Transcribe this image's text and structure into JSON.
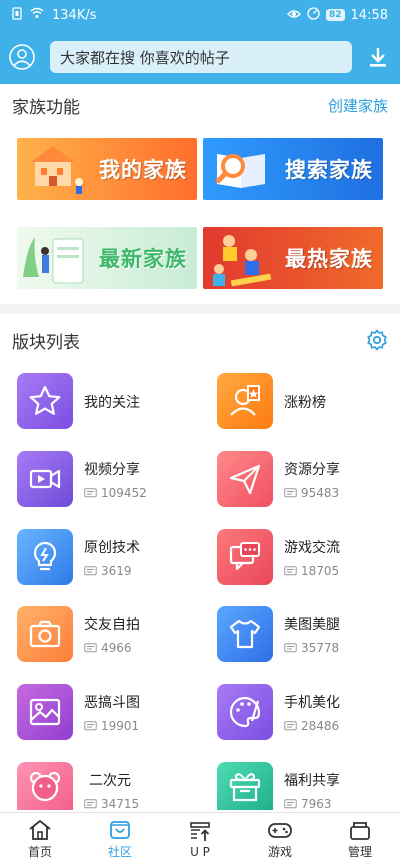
{
  "status": {
    "speed": "134K/s",
    "battery": "82",
    "time": "14:58"
  },
  "header": {
    "search_placeholder": "大家都在搜  你喜欢的帖子"
  },
  "family": {
    "title": "家族功能",
    "link": "创建家族",
    "banners": [
      {
        "label": "我的家族",
        "color_from": "#ff9d3c",
        "color_to": "#ff6e2c"
      },
      {
        "label": "搜索家族",
        "color_from": "#1f7fe6",
        "color_to": "#2fb0ff"
      },
      {
        "label": "最新家族",
        "color_from": "#e6f6e8",
        "color_to": "#cdeed8"
      },
      {
        "label": "最热家族",
        "color_from": "#d92f2f",
        "color_to": "#f06a2a"
      }
    ]
  },
  "boards": {
    "title": "版块列表",
    "items": [
      {
        "name": "我的关注",
        "count": "",
        "icon": "star-icon",
        "c1": "#9b6df0",
        "c2": "#7b4fe0"
      },
      {
        "name": "涨粉榜",
        "count": "",
        "icon": "fans-rank-icon",
        "c1": "#ff9a2c",
        "c2": "#ff7a12"
      },
      {
        "name": "视频分享",
        "count": "109452",
        "icon": "video-icon",
        "c1": "#9b6df0",
        "c2": "#6f4bd8"
      },
      {
        "name": "资源分享",
        "count": "95483",
        "icon": "paper-plane-icon",
        "c1": "#ff7a7a",
        "c2": "#f04f5f"
      },
      {
        "name": "原创技术",
        "count": "3619",
        "icon": "bulb-icon",
        "c1": "#5aa8ff",
        "c2": "#2f7be8"
      },
      {
        "name": "游戏交流",
        "count": "18705",
        "icon": "chat-icon",
        "c1": "#ff6b6b",
        "c2": "#e8475a"
      },
      {
        "name": "交友自拍",
        "count": "4966",
        "icon": "camera-icon",
        "c1": "#ffa75a",
        "c2": "#ff7d3a"
      },
      {
        "name": "美图美腿",
        "count": "35778",
        "icon": "shirt-icon",
        "c1": "#4f9bff",
        "c2": "#2f6ee8"
      },
      {
        "name": "恶搞斗图",
        "count": "19901",
        "icon": "image-icon",
        "c1": "#b95ad8",
        "c2": "#8f3fd0"
      },
      {
        "name": "手机美化",
        "count": "28486",
        "icon": "palette-icon",
        "c1": "#9b6df0",
        "c2": "#7b4fe0"
      },
      {
        "name": "二次元",
        "count": "34715",
        "icon": "bear-icon",
        "c1": "#ff82a8",
        "c2": "#f2608a"
      },
      {
        "name": "福利共享",
        "count": "7963",
        "icon": "gift-icon",
        "c1": "#3fd0a8",
        "c2": "#20b08d"
      }
    ]
  },
  "tabs": [
    {
      "label": "首页",
      "icon": "home-icon",
      "active": false
    },
    {
      "label": "社区",
      "icon": "community-icon",
      "active": true
    },
    {
      "label": "U P",
      "icon": "upload-icon",
      "active": false
    },
    {
      "label": "游戏",
      "icon": "gamepad-icon",
      "active": false
    },
    {
      "label": "管理",
      "icon": "manage-icon",
      "active": false
    }
  ]
}
